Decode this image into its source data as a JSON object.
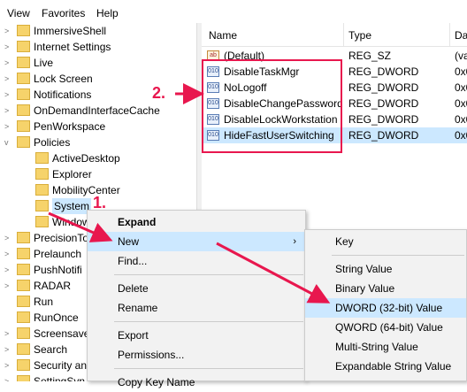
{
  "menubar": [
    "View",
    "Favorites",
    "Help"
  ],
  "tree": [
    {
      "label": "ImmersiveShell",
      "expand": "collapsed"
    },
    {
      "label": "Internet Settings",
      "expand": "collapsed"
    },
    {
      "label": "Live",
      "expand": "collapsed"
    },
    {
      "label": "Lock Screen",
      "expand": "collapsed"
    },
    {
      "label": "Notifications",
      "expand": "collapsed"
    },
    {
      "label": "OnDemandInterfaceCache",
      "expand": "collapsed"
    },
    {
      "label": "PenWorkspace",
      "expand": "collapsed"
    },
    {
      "label": "Policies",
      "expand": "expanded"
    },
    {
      "label": "ActiveDesktop",
      "child": true
    },
    {
      "label": "Explorer",
      "child": true
    },
    {
      "label": "MobilityCenter",
      "child": true
    },
    {
      "label": "System",
      "child": true,
      "selected": true
    },
    {
      "label": "Window",
      "child": true
    },
    {
      "label": "PrecisionTo",
      "expand": "collapsed"
    },
    {
      "label": "Prelaunch",
      "expand": "collapsed"
    },
    {
      "label": "PushNotifi",
      "expand": "collapsed"
    },
    {
      "label": "RADAR",
      "expand": "collapsed"
    },
    {
      "label": "Run",
      "expand": "none"
    },
    {
      "label": "RunOnce",
      "expand": "none"
    },
    {
      "label": "Screensave",
      "expand": "collapsed"
    },
    {
      "label": "Search",
      "expand": "collapsed"
    },
    {
      "label": "Security an",
      "expand": "collapsed"
    },
    {
      "label": "SettingSyn",
      "expand": "collapsed"
    }
  ],
  "columns": {
    "name": "Name",
    "type": "Type",
    "data": "Da"
  },
  "values": [
    {
      "name": "(Default)",
      "type": "REG_SZ",
      "data": "(va",
      "icon": "ab"
    },
    {
      "name": "DisableTaskMgr",
      "type": "REG_DWORD",
      "data": "0x0",
      "icon": "010"
    },
    {
      "name": "NoLogoff",
      "type": "REG_DWORD",
      "data": "0x0",
      "icon": "010"
    },
    {
      "name": "DisableChangePassword",
      "type": "REG_DWORD",
      "data": "0x0",
      "icon": "010"
    },
    {
      "name": "DisableLockWorkstation",
      "type": "REG_DWORD",
      "data": "0x0",
      "icon": "010"
    },
    {
      "name": "HideFastUserSwitching",
      "type": "REG_DWORD",
      "data": "0x0",
      "icon": "010",
      "selected": true
    }
  ],
  "context_menu": [
    {
      "label": "Expand",
      "bold": true
    },
    {
      "label": "New",
      "submenu": true,
      "hot": true
    },
    {
      "label": "Find..."
    },
    {
      "sep": true
    },
    {
      "label": "Delete"
    },
    {
      "label": "Rename"
    },
    {
      "sep": true
    },
    {
      "label": "Export"
    },
    {
      "label": "Permissions..."
    },
    {
      "sep": true
    },
    {
      "label": "Copy Key Name"
    }
  ],
  "submenu": [
    {
      "label": "Key"
    },
    {
      "sep": true
    },
    {
      "label": "String Value"
    },
    {
      "label": "Binary Value"
    },
    {
      "label": "DWORD (32-bit) Value",
      "hot": true
    },
    {
      "label": "QWORD (64-bit) Value"
    },
    {
      "label": "Multi-String Value"
    },
    {
      "label": "Expandable String Value"
    }
  ],
  "annotations": {
    "step1": "1.",
    "step2": "2."
  },
  "colors": {
    "accent": "#e8174e",
    "selection": "#cce8ff",
    "folder": "#f6d36b"
  }
}
